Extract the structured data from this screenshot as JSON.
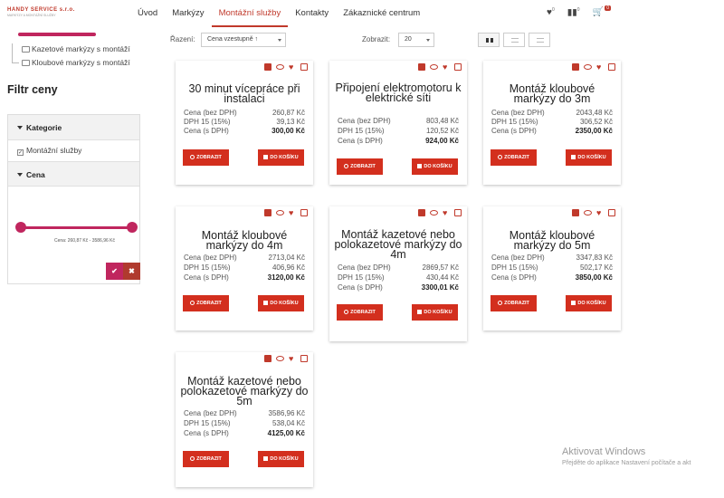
{
  "header": {
    "logo_main": "HANDY SERVICE s.r.o.",
    "logo_sub": "MARKÝZY A MONTÁŽNÍ SLUŽBY",
    "nav": [
      {
        "label": "Úvod",
        "active": false
      },
      {
        "label": "Markýzy",
        "active": false
      },
      {
        "label": "Montážní služby",
        "active": true
      },
      {
        "label": "Kontakty",
        "active": false
      },
      {
        "label": "Zákaznické centrum",
        "active": false
      }
    ],
    "wishlist_count": "0",
    "compare_count": "0",
    "cart_count": "0",
    "accent_color": "#c0392b"
  },
  "sidebar": {
    "categories": [
      "Kazetové markýzy s montáží",
      "Kloubové markýzy s montáží"
    ],
    "filter_title": "Filtr ceny",
    "section_category": "Kategorie",
    "category_option": "Montážní služby",
    "category_checked": true,
    "section_price": "Cena",
    "price_range": "Cena: 260,87 Kč - 3586,96 Kč",
    "slider_color": "#c0265e",
    "apply_icon": "check-icon",
    "reset_icon": "close-icon"
  },
  "toolbar": {
    "sort_label": "Řazení:",
    "sort_value": "Cena vzestupně ↑",
    "show_label": "Zobrazit:",
    "show_value": "20",
    "view_modes": [
      "grid-view-icon",
      "list-view-icon",
      "compact-view-icon"
    ]
  },
  "products": [
    {
      "title": "30 minut vícepráce při instalaci",
      "price_without_vat": "260,87 Kč",
      "vat": "39,13 Kč",
      "price_with_vat": "300,00 Kč"
    },
    {
      "title": "Připojení elektromotoru k elektrické síti",
      "price_without_vat": "803,48 Kč",
      "vat": "120,52 Kč",
      "price_with_vat": "924,00 Kč"
    },
    {
      "title": "Montáž kloubové markýzy do 3m",
      "price_without_vat": "2043,48 Kč",
      "vat": "306,52 Kč",
      "price_with_vat": "2350,00 Kč"
    },
    {
      "title": "Montáž kloubové markýzy do 4m",
      "price_without_vat": "2713,04 Kč",
      "vat": "406,96 Kč",
      "price_with_vat": "3120,00 Kč"
    },
    {
      "title": "Montáž kazetové nebo polokazetové markýzy do 4m",
      "price_without_vat": "2869,57 Kč",
      "vat": "430,44 Kč",
      "price_with_vat": "3300,01 Kč"
    },
    {
      "title": "Montáž kloubové markýzy do 5m",
      "price_without_vat": "3347,83 Kč",
      "vat": "502,17 Kč",
      "price_with_vat": "3850,00 Kč"
    },
    {
      "title": "Montáž kazetové nebo polokazetové markýzy do 5m",
      "price_without_vat": "3586,96 Kč",
      "vat": "538,04 Kč",
      "price_with_vat": "4125,00 Kč"
    }
  ],
  "labels": {
    "price_without_vat": "Cena (bez DPH)",
    "vat": "DPH 15 (15%)",
    "price_with_vat": "Cena (s DPH)",
    "show_button": "ZOBRAZIT",
    "cart_button": "DO KOŠÍKU"
  },
  "watermark": {
    "title": "Aktivovat Windows",
    "subtitle": "Přejděte do aplikace Nastavení počítače a akt"
  }
}
